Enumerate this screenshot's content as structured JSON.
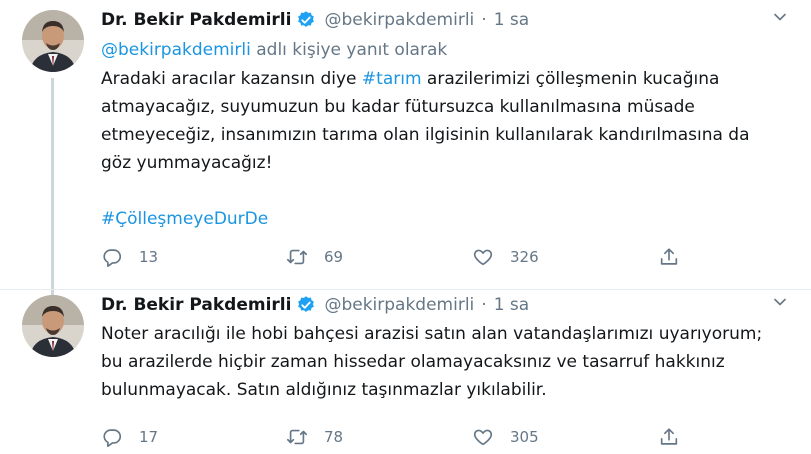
{
  "colors": {
    "accent": "#1b95e0",
    "muted": "#657786",
    "text": "#14171a",
    "divider": "#e6ecf0",
    "verified": "#1da1f2"
  },
  "tweets": [
    {
      "name": "Dr. Bekir Pakdemirli",
      "handle": "@bekirpakdemirli",
      "separator": "·",
      "time": "1 sa",
      "reply_to": {
        "handle": "@bekirpakdemirli",
        "text": " adlı kişiye yanıt olarak"
      },
      "body": {
        "line1_pre": "Aradaki aracılar kazansın diye ",
        "hashtag": "#tarım",
        "line1_post": " arazilerimizi çölleşmenin kucağına",
        "lines": [
          "atmayacağız, suyumuzun bu kadar fütursuzca kullanılmasına müsade",
          "etmeyeceğiz, insanımızın tarıma olan ilgisinin kullanılarak kandırılmasına da",
          "göz yummayacağız!"
        ],
        "tag_line": "#ÇölleşmeyeDurDe"
      },
      "actions": {
        "reply": "13",
        "retweet": "69",
        "like": "326"
      },
      "icons": [
        "avatar-photo",
        "verified-icon",
        "caret-down-icon",
        "reply-icon",
        "retweet-icon",
        "like-icon",
        "share-icon"
      ]
    },
    {
      "name": "Dr. Bekir Pakdemirli",
      "handle": "@bekirpakdemirli",
      "separator": "·",
      "time": "1 sa",
      "body": {
        "lines": [
          "Noter aracılığı ile hobi bahçesi arazisi satın alan vatandaşlarımızı uyarıyorum;",
          "bu arazilerde hiçbir zaman hissedar olamayacaksınız ve tasarruf hakkınız",
          "bulunmayacak. Satın aldığınız taşınmazlar yıkılabilir."
        ]
      },
      "actions": {
        "reply": "17",
        "retweet": "78",
        "like": "305"
      },
      "icons": [
        "avatar-photo",
        "verified-icon",
        "caret-down-icon",
        "reply-icon",
        "retweet-icon",
        "like-icon",
        "share-icon"
      ]
    }
  ]
}
